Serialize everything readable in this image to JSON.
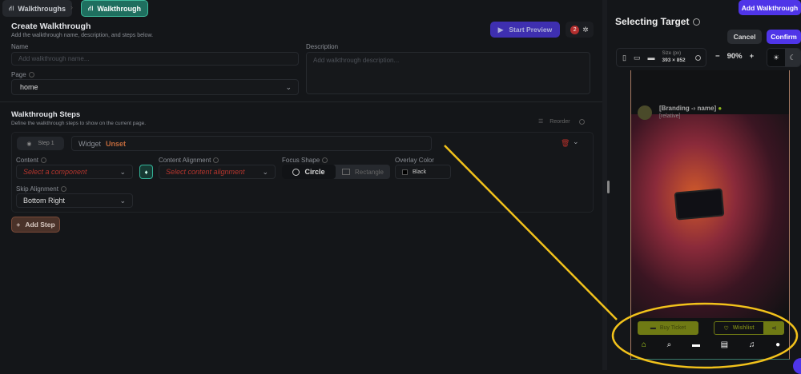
{
  "breadcrumb": {
    "items": [
      "Walkthroughs",
      "Walkthrough"
    ]
  },
  "create": {
    "title": "Create Walkthrough",
    "subtitle": "Add the walkthrough name, description, and steps below.",
    "name_label": "Name",
    "name_placeholder": "Add walkthrough name...",
    "desc_label": "Description",
    "desc_placeholder": "Add walkthrough description...",
    "page_label": "Page",
    "page_value": "home",
    "start_preview": "Start Preview",
    "issues_count": "2"
  },
  "steps": {
    "title": "Walkthrough Steps",
    "subtitle": "Define the walkthrough steps to show on the current page.",
    "reorder": "Reorder",
    "step_label": "Step 1",
    "widget_label": "Widget",
    "widget_value": "Unset",
    "content_label": "Content",
    "content_placeholder": "Select a component",
    "alignment_label": "Content Alignment",
    "alignment_placeholder": "Select content alignment",
    "focus_label": "Focus Shape",
    "focus_options": [
      "Circle",
      "Rectangle"
    ],
    "overlay_label": "Overlay Color",
    "overlay_value": "Black",
    "skip_label": "Skip Alignment",
    "skip_value": "Bottom Right",
    "add_step": "Add Step"
  },
  "target": {
    "title": "Selecting Target",
    "add_walkthrough": "Add Walkthrough",
    "cancel": "Cancel",
    "confirm": "Confirm",
    "size_label": "Size (px)",
    "size_value": "393 × 852",
    "zoom": "90%",
    "zoom_minus": "−",
    "zoom_plus": "+"
  },
  "phone": {
    "brand": "[Branding -› name]",
    "relative": "[relative]",
    "buy_ticket": "Buy Ticket",
    "wishlist": "Wishlist"
  },
  "colors": {
    "accent": "#4f35e8",
    "teal": "#1f6f5f",
    "olive": "#6f7a14",
    "annotation": "#f2c21b"
  }
}
